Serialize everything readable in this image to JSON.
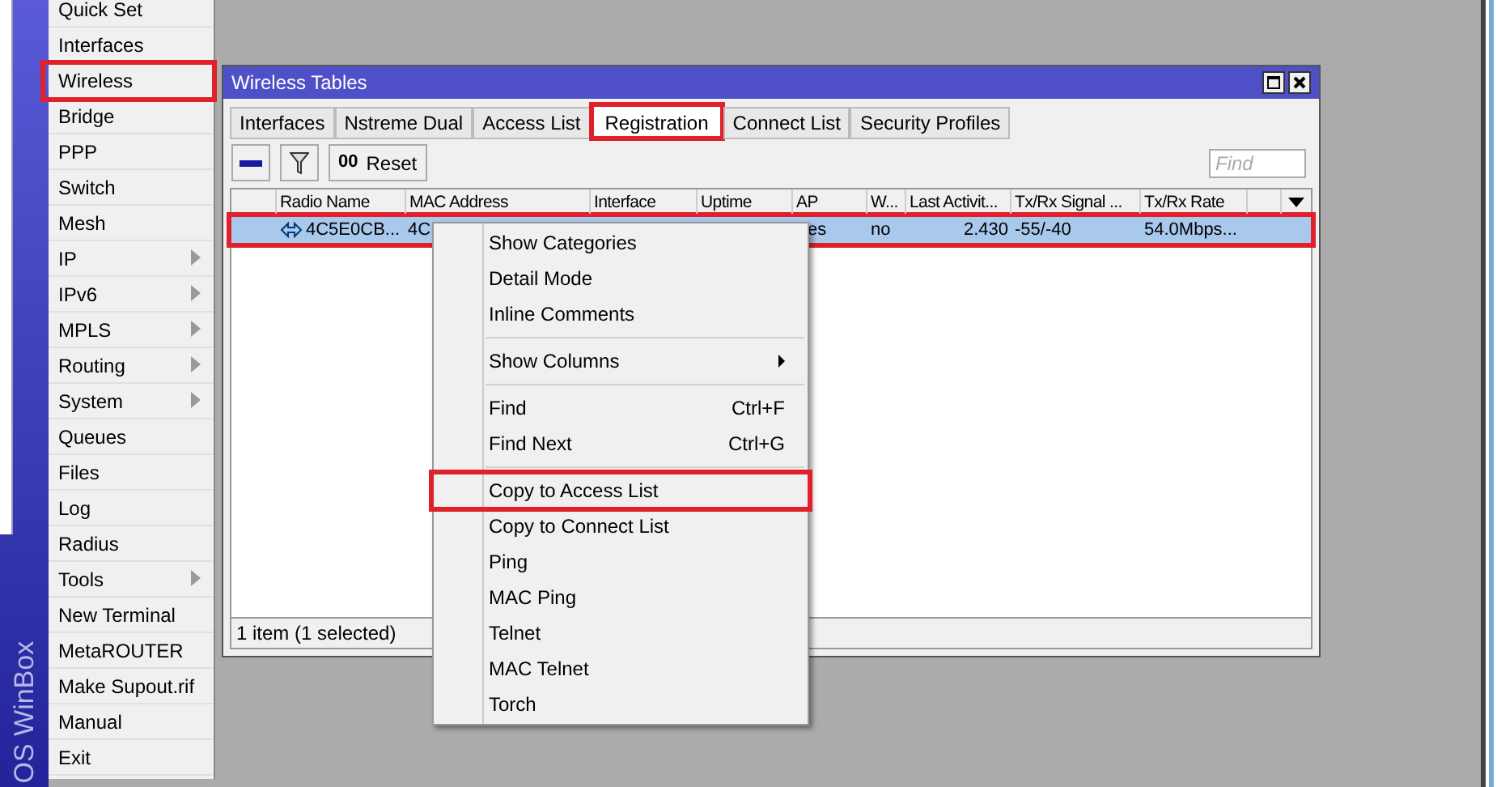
{
  "brand": "OS WinBox",
  "sidebar": {
    "items": [
      {
        "label": "Quick Set",
        "submenu": false,
        "highlighted": false
      },
      {
        "label": "Interfaces",
        "submenu": false,
        "highlighted": false
      },
      {
        "label": "Wireless",
        "submenu": false,
        "highlighted": true
      },
      {
        "label": "Bridge",
        "submenu": false,
        "highlighted": false
      },
      {
        "label": "PPP",
        "submenu": false,
        "highlighted": false
      },
      {
        "label": "Switch",
        "submenu": false,
        "highlighted": false
      },
      {
        "label": "Mesh",
        "submenu": false,
        "highlighted": false
      },
      {
        "label": "IP",
        "submenu": true,
        "highlighted": false
      },
      {
        "label": "IPv6",
        "submenu": true,
        "highlighted": false
      },
      {
        "label": "MPLS",
        "submenu": true,
        "highlighted": false
      },
      {
        "label": "Routing",
        "submenu": true,
        "highlighted": false
      },
      {
        "label": "System",
        "submenu": true,
        "highlighted": false
      },
      {
        "label": "Queues",
        "submenu": false,
        "highlighted": false
      },
      {
        "label": "Files",
        "submenu": false,
        "highlighted": false
      },
      {
        "label": "Log",
        "submenu": false,
        "highlighted": false
      },
      {
        "label": "Radius",
        "submenu": false,
        "highlighted": false
      },
      {
        "label": "Tools",
        "submenu": true,
        "highlighted": false
      },
      {
        "label": "New Terminal",
        "submenu": false,
        "highlighted": false
      },
      {
        "label": "MetaROUTER",
        "submenu": false,
        "highlighted": false
      },
      {
        "label": "Make Supout.rif",
        "submenu": false,
        "highlighted": false
      },
      {
        "label": "Manual",
        "submenu": false,
        "highlighted": false
      },
      {
        "label": "Exit",
        "submenu": false,
        "highlighted": false
      }
    ]
  },
  "window": {
    "title": "Wireless Tables",
    "tabs": [
      {
        "label": "Interfaces",
        "selected": false,
        "highlighted": false
      },
      {
        "label": "Nstreme Dual",
        "selected": false,
        "highlighted": false
      },
      {
        "label": "Access List",
        "selected": false,
        "highlighted": false
      },
      {
        "label": "Registration",
        "selected": true,
        "highlighted": true
      },
      {
        "label": "Connect List",
        "selected": false,
        "highlighted": false
      },
      {
        "label": "Security Profiles",
        "selected": false,
        "highlighted": false
      }
    ],
    "toolbar": {
      "reset_icon": "00",
      "reset_label": "Reset",
      "find_placeholder": "Find"
    },
    "table": {
      "columns": [
        "",
        "Radio Name",
        "MAC Address",
        "Interface",
        "Uptime",
        "AP",
        "W...",
        "Last Activit...",
        "Tx/Rx Signal ...",
        "Tx/Rx Rate",
        ""
      ],
      "rows": [
        {
          "selected": true,
          "highlighted": true,
          "cells": [
            "",
            "4C5E0CB...",
            "4C",
            "",
            "",
            "es",
            "no",
            "2.430",
            "-55/-40",
            "54.0Mbps...",
            ""
          ]
        }
      ]
    },
    "status": "1 item (1 selected)"
  },
  "context_menu": {
    "items": [
      {
        "kind": "item",
        "label": "Show Categories",
        "highlighted": false
      },
      {
        "kind": "item",
        "label": "Detail Mode",
        "highlighted": false
      },
      {
        "kind": "item",
        "label": "Inline Comments",
        "highlighted": false
      },
      {
        "kind": "separator"
      },
      {
        "kind": "submenu",
        "label": "Show Columns",
        "highlighted": false
      },
      {
        "kind": "separator"
      },
      {
        "kind": "item",
        "label": "Find",
        "shortcut": "Ctrl+F",
        "highlighted": false
      },
      {
        "kind": "item",
        "label": "Find Next",
        "shortcut": "Ctrl+G",
        "highlighted": false
      },
      {
        "kind": "separator"
      },
      {
        "kind": "item",
        "label": "Copy to Access List",
        "highlighted": true
      },
      {
        "kind": "item",
        "label": "Copy to Connect List",
        "highlighted": false
      },
      {
        "kind": "item",
        "label": "Ping",
        "highlighted": false
      },
      {
        "kind": "item",
        "label": "MAC Ping",
        "highlighted": false
      },
      {
        "kind": "item",
        "label": "Telnet",
        "highlighted": false
      },
      {
        "kind": "item",
        "label": "MAC Telnet",
        "highlighted": false
      },
      {
        "kind": "item",
        "label": "Torch",
        "highlighted": false
      }
    ]
  }
}
